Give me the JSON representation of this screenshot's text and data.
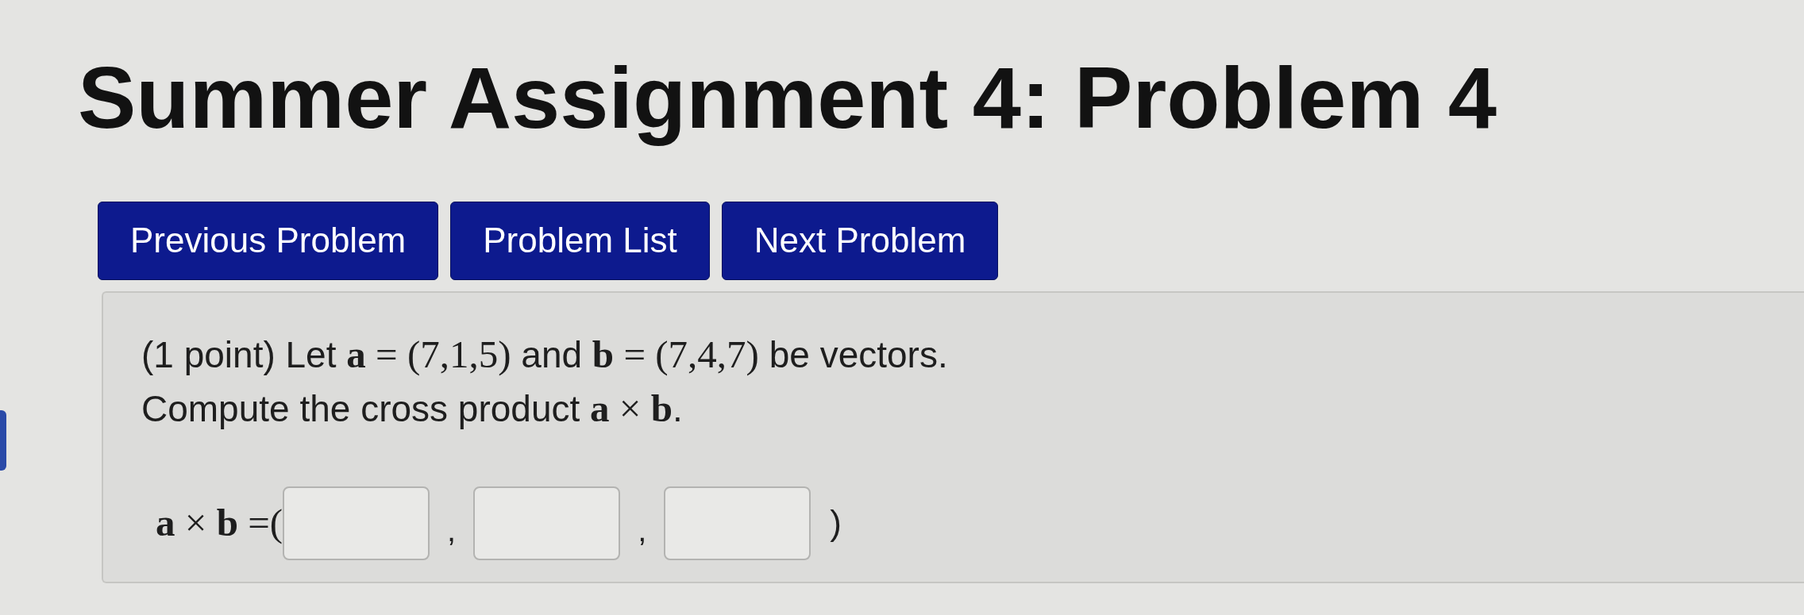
{
  "title": "Summer Assignment 4: Problem 4",
  "nav_buttons": [
    {
      "label": "Previous Problem"
    },
    {
      "label": "Problem List"
    },
    {
      "label": "Next Problem"
    }
  ],
  "problem": {
    "statement": [
      {
        "kind": "text",
        "text": "(1 point) Let "
      },
      {
        "kind": "math",
        "text": "**a** = (7,1,5)"
      },
      {
        "kind": "text",
        "text": " and "
      },
      {
        "kind": "math",
        "text": "**b** = (7,4,7)"
      },
      {
        "kind": "text",
        "text": " be vectors."
      }
    ],
    "instruction": [
      {
        "kind": "text",
        "text": "Compute the cross product "
      },
      {
        "kind": "math",
        "text": "**a** × **b**"
      },
      {
        "kind": "text",
        "text": "."
      }
    ],
    "answer_row": [
      {
        "kind": "math",
        "text": "**a** × **b** =("
      },
      {
        "kind": "field"
      },
      {
        "kind": "comma",
        "text": ","
      },
      {
        "kind": "field"
      },
      {
        "kind": "comma",
        "text": ","
      },
      {
        "kind": "field"
      },
      {
        "kind": "paren",
        "text": ")"
      }
    ]
  }
}
